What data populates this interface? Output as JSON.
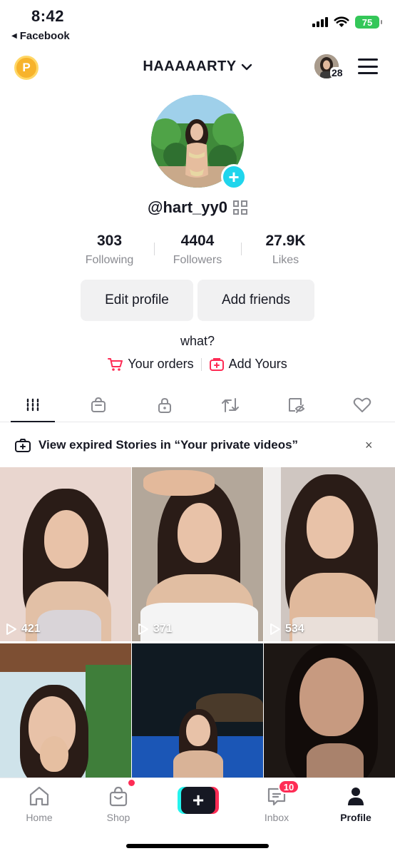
{
  "status_bar": {
    "time": "8:42",
    "back_app": "Facebook",
    "battery": "75"
  },
  "header": {
    "coin_label": "P",
    "username": "HAAAAARTY",
    "account_count": "28"
  },
  "profile": {
    "handle": "@hart_yy0",
    "stats": [
      {
        "value": "303",
        "label": "Following"
      },
      {
        "value": "4404",
        "label": "Followers"
      },
      {
        "value": "27.9K",
        "label": "Likes"
      }
    ],
    "edit_profile_label": "Edit profile",
    "add_friends_label": "Add friends",
    "bio": "what?",
    "your_orders_label": "Your orders",
    "add_yours_label": "Add Yours"
  },
  "tabs": [
    {
      "icon": "videos-grid-icon",
      "active": true
    },
    {
      "icon": "shop-bag-icon",
      "active": false
    },
    {
      "icon": "private-lock-icon",
      "active": false
    },
    {
      "icon": "repost-icon",
      "active": false
    },
    {
      "icon": "hidden-eye-icon",
      "active": false
    },
    {
      "icon": "liked-heart-icon",
      "active": false
    }
  ],
  "banner": {
    "text": "View expired Stories in “Your private videos”",
    "close": "×"
  },
  "videos": [
    {
      "views": "421"
    },
    {
      "views": "371"
    },
    {
      "views": "534"
    },
    {
      "views": ""
    },
    {
      "views": ""
    },
    {
      "views": ""
    }
  ],
  "bottom_nav": {
    "home": "Home",
    "shop": "Shop",
    "create": "+",
    "inbox": "Inbox",
    "inbox_badge": "10",
    "profile": "Profile"
  },
  "colors": {
    "accent_red": "#fe2c55",
    "accent_cyan": "#25f4ee",
    "badge_teal": "#20d5ec",
    "battery_green": "#34c759"
  }
}
